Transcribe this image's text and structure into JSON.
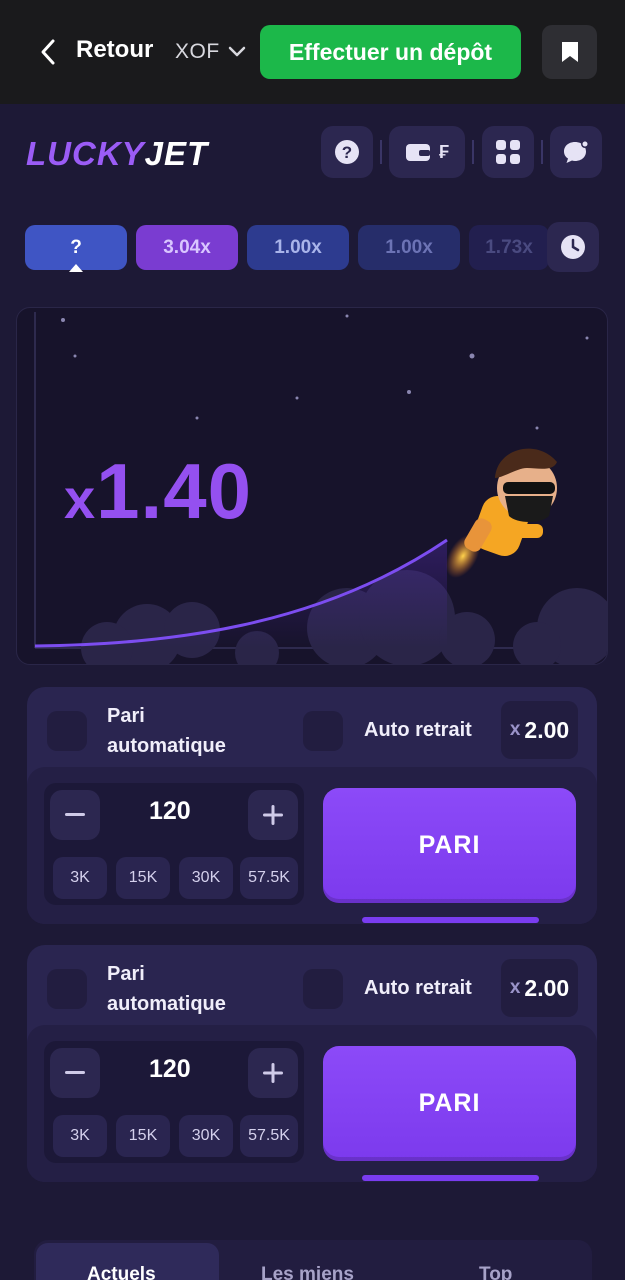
{
  "topbar": {
    "back_label": "Retour",
    "currency": "XOF",
    "deposit_label": "Effectuer un dépôt"
  },
  "header": {
    "logo_part1": "LUCKY",
    "logo_part2": "JET",
    "wallet_symbol": "₣"
  },
  "history": {
    "items": [
      "?",
      "3.04x",
      "1.00x",
      "1.00x",
      "1.73x"
    ]
  },
  "game": {
    "multiplier_prefix": "x",
    "multiplier_value": "1.40"
  },
  "bets": [
    {
      "auto_bet_line1": "Pari",
      "auto_bet_line2": "automatique",
      "auto_cashout_label": "Auto retrait",
      "cashout_prefix": "x",
      "cashout_value": "2.00",
      "amount": "120",
      "quick_amounts": [
        "3K",
        "15K",
        "30K",
        "57.5K"
      ],
      "bet_label": "PARI"
    },
    {
      "auto_bet_line1": "Pari",
      "auto_bet_line2": "automatique",
      "auto_cashout_label": "Auto retrait",
      "cashout_prefix": "x",
      "cashout_value": "2.00",
      "amount": "120",
      "quick_amounts": [
        "3K",
        "15K",
        "30K",
        "57.5K"
      ],
      "bet_label": "PARI"
    }
  ],
  "tabs": [
    "Actuels",
    "Les miens",
    "Top"
  ],
  "colors": {
    "accent_purple": "#7c3aed",
    "deposit_green": "#1cb84a",
    "background": "#1d1936"
  }
}
